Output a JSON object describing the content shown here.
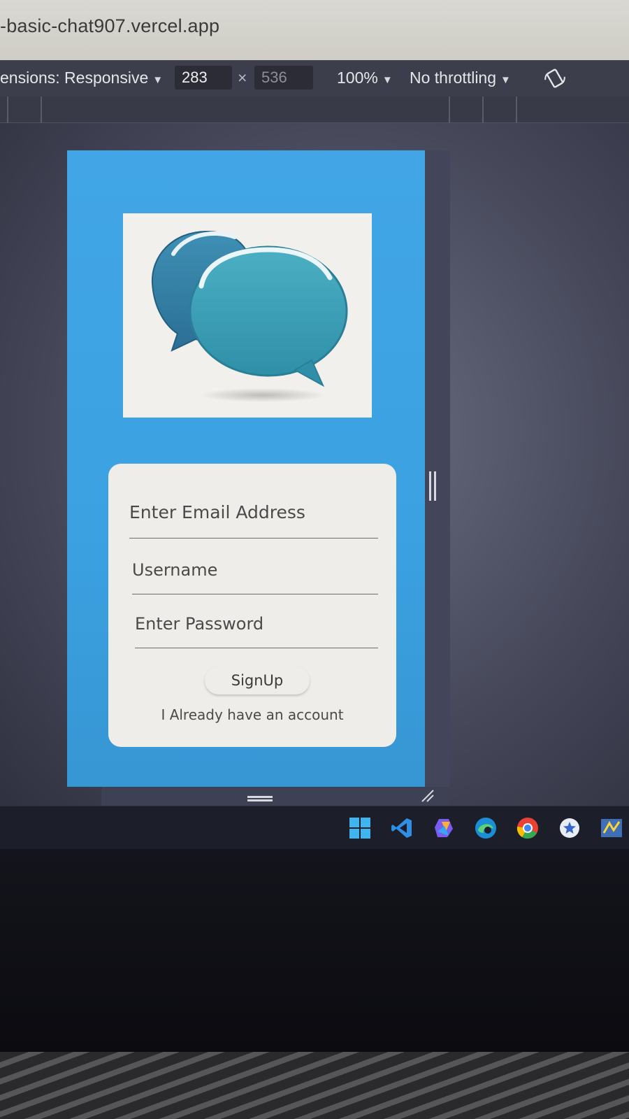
{
  "browser": {
    "url": "-basic-chat907.vercel.app"
  },
  "devtools": {
    "dimensions_label": "ensions: Responsive",
    "width": "283",
    "times": "×",
    "height": "536",
    "zoom": "100%",
    "throttling": "No throttling"
  },
  "app": {
    "email_placeholder": "Enter Email Address",
    "username_placeholder": "Username",
    "password_placeholder": "Enter Password",
    "signup_label": "SignUp",
    "login_link": "I Already have an account",
    "background_color": "#3ba1e1",
    "logo_icon": "chat-bubbles-logo"
  },
  "taskbar": {
    "icons": [
      "windows-start-icon",
      "vscode-icon",
      "copilot-icon",
      "edge-icon",
      "chrome-icon",
      "bookmark-app-icon",
      "python-idle-icon"
    ]
  }
}
